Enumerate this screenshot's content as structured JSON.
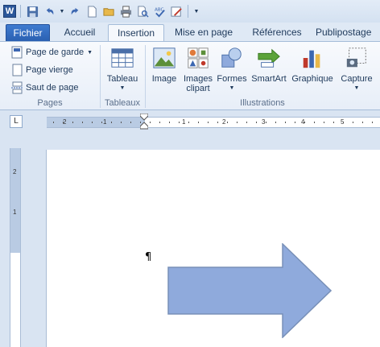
{
  "quick_access": {
    "logo_letter": "W"
  },
  "tabs": [
    {
      "label": "Fichier"
    },
    {
      "label": "Accueil"
    },
    {
      "label": "Insertion"
    },
    {
      "label": "Mise en page"
    },
    {
      "label": "Références"
    },
    {
      "label": "Publipostage"
    }
  ],
  "ribbon": {
    "pages": {
      "label": "Pages",
      "items": [
        "Page de garde",
        "Page vierge",
        "Saut de page"
      ]
    },
    "tableaux": {
      "label": "Tableaux",
      "tableau": "Tableau"
    },
    "illustrations": {
      "label": "Illustrations",
      "image": "Image",
      "images_clipart_1": "Images",
      "images_clipart_2": "clipart",
      "formes": "Formes",
      "smartart": "SmartArt",
      "graphique": "Graphique",
      "capture": "Capture"
    }
  },
  "ruler": {
    "corner": "L",
    "h_numbers": [
      "2",
      "1",
      "1",
      "2",
      "3",
      "4",
      "5"
    ],
    "v_numbers": [
      "2",
      "1"
    ]
  },
  "document": {
    "colors": {
      "arrow_fill": "#8faadc",
      "arrow_stroke": "#7890b8"
    }
  }
}
